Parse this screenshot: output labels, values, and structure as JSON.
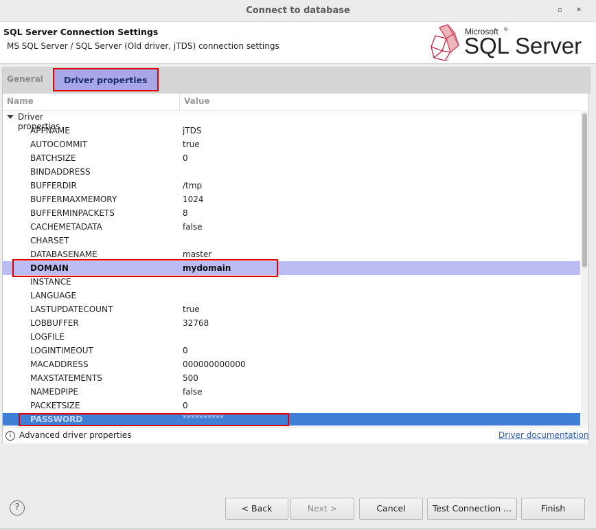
{
  "window": {
    "title": "Connect to database",
    "maximize_glyph": "▫",
    "close_glyph": "✕"
  },
  "header": {
    "title": "SQL Server Connection Settings",
    "subtitle": "MS SQL Server / SQL Server (Old driver, jTDS) connection settings",
    "logo_small": "Microsoft",
    "logo_reg": "®",
    "logo_large": "SQL Server",
    "logo_tm": "™"
  },
  "tabs": [
    {
      "label": "General",
      "active": false
    },
    {
      "label": "Driver properties",
      "active": true
    }
  ],
  "table": {
    "columns": [
      "Name",
      "Value"
    ],
    "group": "Driver properties",
    "rows": [
      {
        "name": "APPNAME",
        "value": "jTDS"
      },
      {
        "name": "AUTOCOMMIT",
        "value": "true"
      },
      {
        "name": "BATCHSIZE",
        "value": "0"
      },
      {
        "name": "BINDADDRESS",
        "value": ""
      },
      {
        "name": "BUFFERDIR",
        "value": "/tmp"
      },
      {
        "name": "BUFFERMAXMEMORY",
        "value": "1024"
      },
      {
        "name": "BUFFERMINPACKETS",
        "value": "8"
      },
      {
        "name": "CACHEMETADATA",
        "value": "false"
      },
      {
        "name": "CHARSET",
        "value": ""
      },
      {
        "name": "DATABASENAME",
        "value": "master"
      },
      {
        "name": "DOMAIN",
        "value": "mydomain"
      },
      {
        "name": "INSTANCE",
        "value": ""
      },
      {
        "name": "LANGUAGE",
        "value": ""
      },
      {
        "name": "LASTUPDATECOUNT",
        "value": "true"
      },
      {
        "name": "LOBBUFFER",
        "value": "32768"
      },
      {
        "name": "LOGFILE",
        "value": ""
      },
      {
        "name": "LOGINTIMEOUT",
        "value": "0"
      },
      {
        "name": "MACADDRESS",
        "value": "000000000000"
      },
      {
        "name": "MAXSTATEMENTS",
        "value": "500"
      },
      {
        "name": "NAMEDPIPE",
        "value": "false"
      },
      {
        "name": "PACKETSIZE",
        "value": "0"
      },
      {
        "name": "PASSWORD",
        "value": "**********"
      }
    ]
  },
  "footer": {
    "info_glyph": "i",
    "advanced_label": "Advanced driver properties",
    "doc_link": "Driver documentation"
  },
  "buttons": {
    "help_glyph": "?",
    "back": "< Back",
    "next": "Next >",
    "cancel": "Cancel",
    "test": "Test Connection ...",
    "finish": "Finish"
  },
  "colors": {
    "selected_row": "#bcbcf4",
    "active_row": "#3f7fd8",
    "highlight_box": "#e00000",
    "logo_red": "#c8102e"
  }
}
